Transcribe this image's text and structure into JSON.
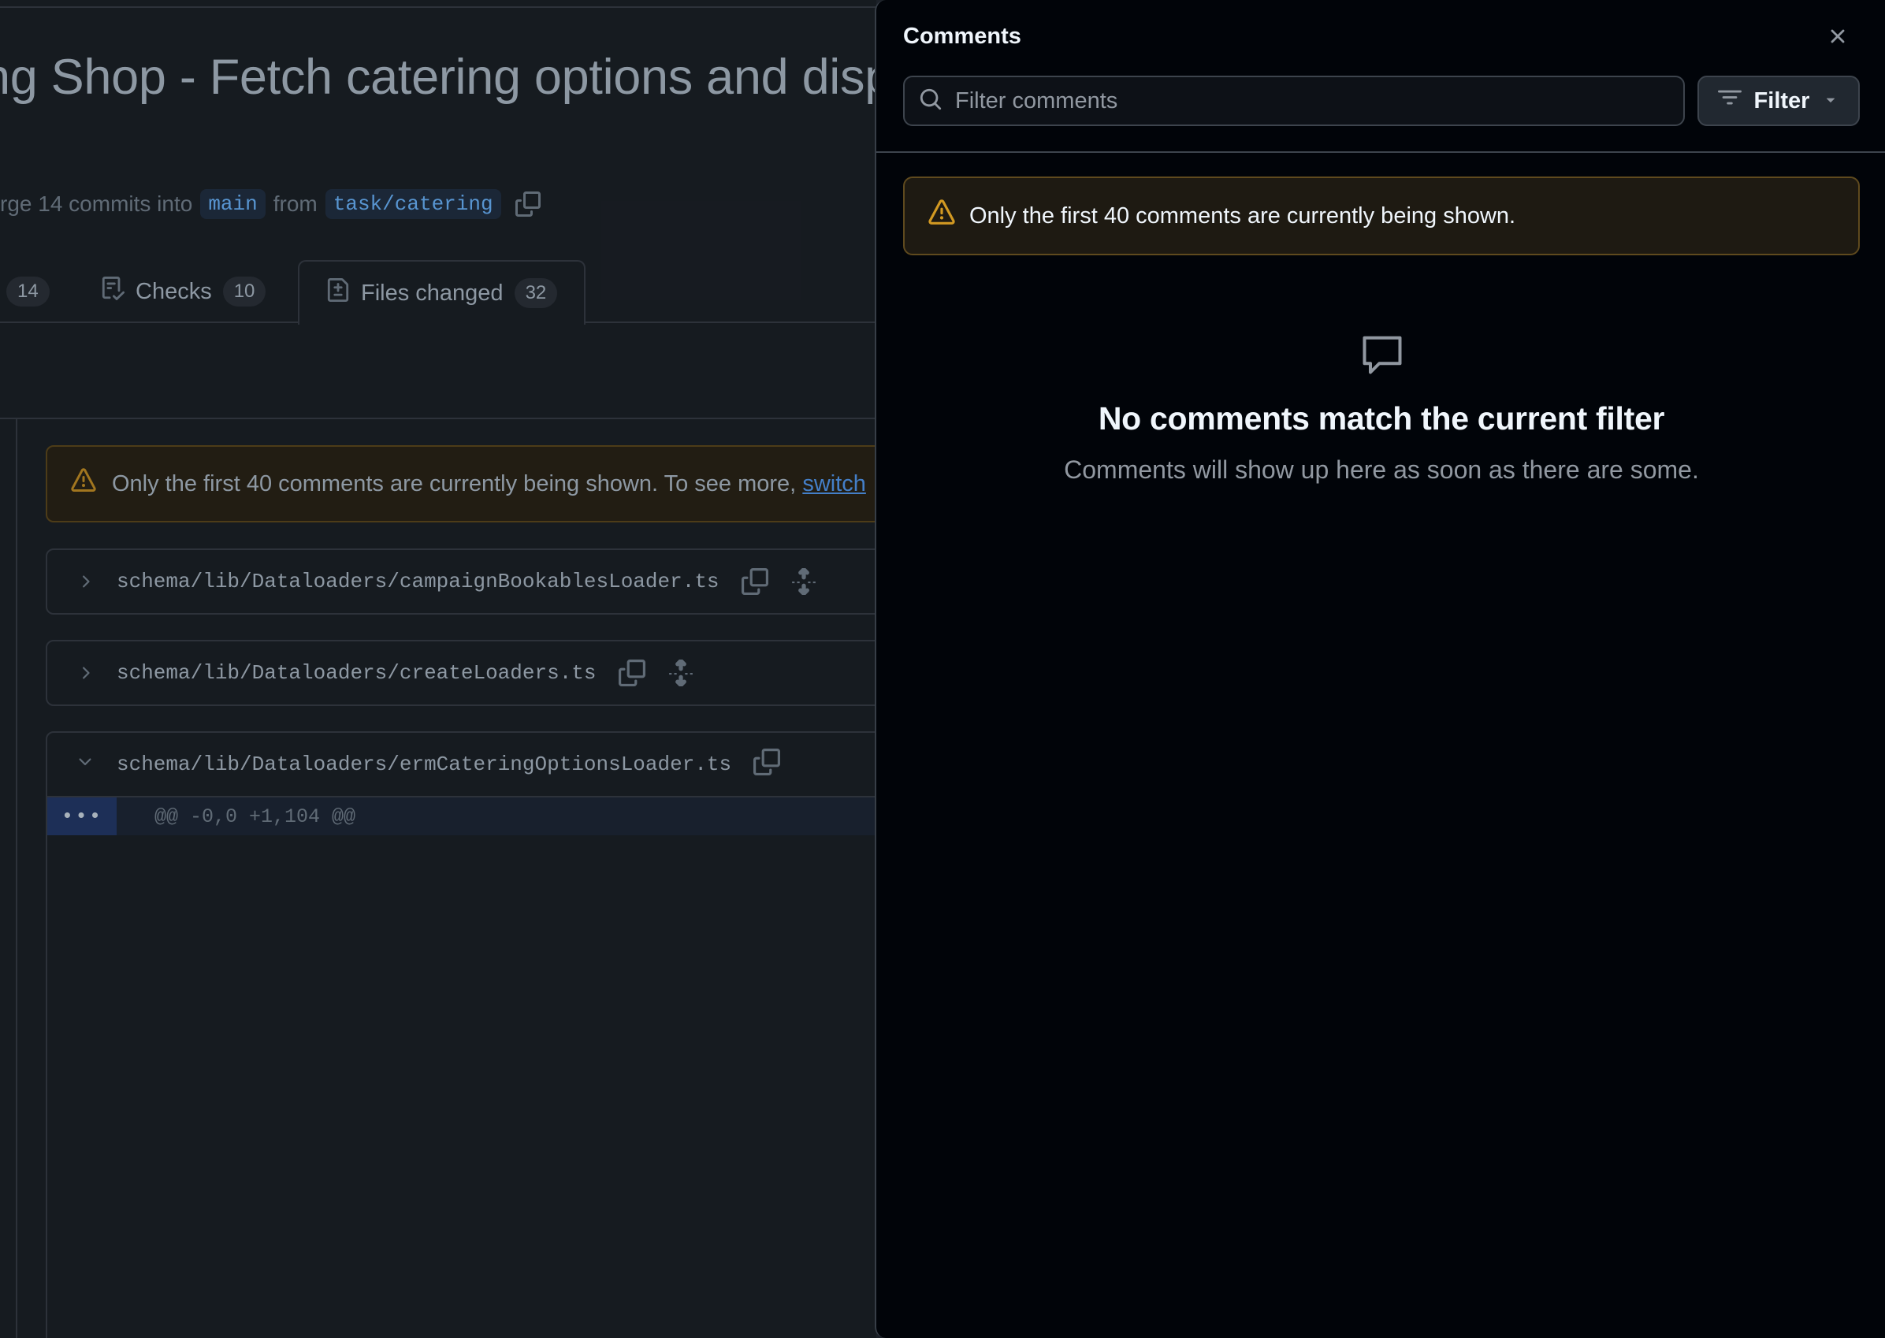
{
  "pr": {
    "title": "ng Shop - Fetch catering options and disp",
    "meta_prefix": "rge 14 commits into",
    "base_branch": "main",
    "meta_from": "from",
    "head_branch": "task/catering"
  },
  "tabs": [
    {
      "label": "",
      "count": "14"
    },
    {
      "label": "Checks",
      "count": "10"
    },
    {
      "label": "Files changed",
      "count": "32"
    }
  ],
  "files_view": {
    "warning_text": "Only the first 40 comments are currently being shown. To see more,",
    "warning_link": "switch",
    "files": [
      {
        "path": "schema/lib/Dataloaders/campaignBookablesLoader.ts"
      },
      {
        "path": "schema/lib/Dataloaders/createLoaders.ts"
      },
      {
        "path": "schema/lib/Dataloaders/ermCateringOptionsLoader.ts"
      }
    ],
    "hunk_expand": "•••",
    "hunk_header": "@@ -0,0 +1,104 @@"
  },
  "panel": {
    "title": "Comments",
    "search_placeholder": "Filter comments",
    "filter_label": "Filter",
    "warning": "Only the first 40 comments are currently being shown.",
    "empty_title": "No comments match the current filter",
    "empty_subtitle": "Comments will show up here as soon as there are some."
  },
  "icons": {
    "close": "x-icon",
    "search": "search-icon",
    "filter": "filter-icon",
    "warning": "alert-icon",
    "empty": "comment-icon",
    "copy": "copy-icon",
    "expand": "fold-icon"
  },
  "colors": {
    "panel_bg": "#010409",
    "page_bg": "#1c2128",
    "warning_accent": "#d29922",
    "link": "#539bf5"
  }
}
